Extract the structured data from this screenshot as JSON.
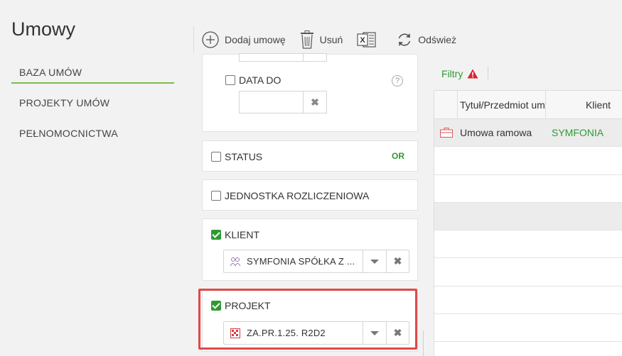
{
  "page": {
    "title": "Umowy"
  },
  "nav": {
    "items": [
      {
        "label": "BAZA UMÓW",
        "active": true
      },
      {
        "label": "PROJEKTY UMÓW",
        "active": false
      },
      {
        "label": "PEŁNOMOCNICTWA",
        "active": false
      }
    ]
  },
  "toolbar": {
    "add_label": "Dodaj umowę",
    "delete_label": "Usuń",
    "refresh_label": "Odśwież",
    "export_icon": "excel-icon"
  },
  "filters": {
    "date_to": {
      "label": "DATA DO",
      "checked": false,
      "value": "",
      "help": "?"
    },
    "status": {
      "label": "STATUS",
      "checked": false,
      "or_label": "OR"
    },
    "unit": {
      "label": "JEDNOSTKA ROZLICZENIOWA",
      "checked": false
    },
    "client": {
      "label": "KLIENT",
      "checked": true,
      "value": "SYMFONIA SPÓŁKA Z ..."
    },
    "project": {
      "label": "PROJEKT",
      "checked": true,
      "value": "ZA.PR.1.25. R2D2"
    }
  },
  "grid": {
    "filters_label": "Filtry",
    "columns": [
      "Tytuł/Przedmiot umowy",
      "Klient"
    ],
    "rows": [
      {
        "title": "Umowa ramowa",
        "client": "SYMFONIA"
      }
    ]
  },
  "colors": {
    "accent": "#2e9a33",
    "nav_underline": "#7bbd4a",
    "highlight": "#e04848",
    "warning": "#d9232d"
  }
}
